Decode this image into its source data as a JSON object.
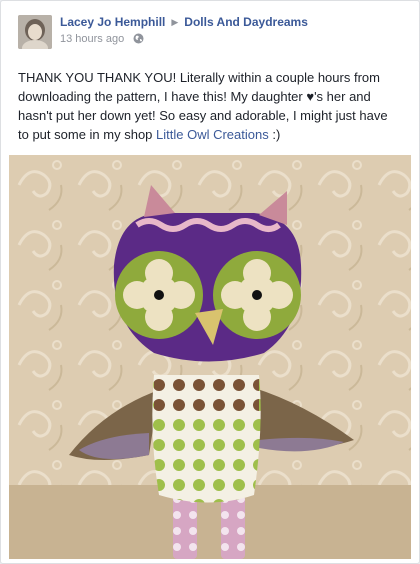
{
  "post": {
    "author": "Lacey Jo Hemphill",
    "page": "Dolls And Daydreams",
    "timestamp": "13 hours ago",
    "privacy_icon": "globe-icon",
    "text_before_heart": "THANK YOU THANK YOU! Literally within a couple hours from downloading the pattern, I have this! My daughter ",
    "heart": "♥",
    "text_after_heart": "'s her and hasn't put her down yet! So easy and adorable, I might just have to put some in my shop ",
    "shop_link": "Little Owl Creations",
    "text_end": " :)"
  },
  "colors": {
    "link": "#3b5998",
    "meta": "#90949c",
    "body_text": "#1d2129"
  }
}
